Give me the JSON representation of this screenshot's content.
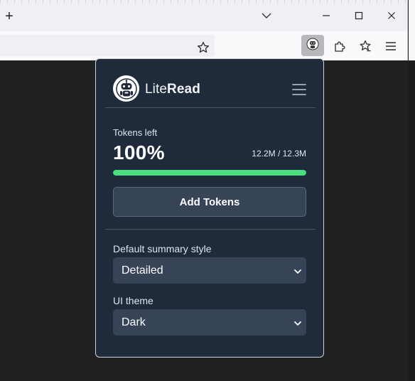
{
  "browser": {
    "new_tab_glyph": "+",
    "icons": {
      "new_tab": "plus-icon",
      "tab_list": "chevron-down-icon",
      "minimize": "minimize-icon",
      "maximize": "maximize-icon",
      "close": "close-icon",
      "bookmark": "star-icon",
      "active_extension": "robot-icon",
      "extensions": "puzzle-piece-icon",
      "favorites": "star-list-icon",
      "menu": "hamburger-menu-icon"
    }
  },
  "popup": {
    "brand": {
      "prefix": "Lite",
      "suffix": "Read"
    },
    "logo_icon": "robot-icon",
    "menu_icon": "hamburger-menu-icon",
    "tokens": {
      "label": "Tokens left",
      "percent_text": "100%",
      "count_text": "12.2M / 12.3M",
      "progress_fraction": 1.0,
      "progress_color": "#4ade80"
    },
    "add_tokens_label": "Add Tokens",
    "summary_style": {
      "label": "Default summary style",
      "value": "Detailed"
    },
    "ui_theme": {
      "label": "UI theme",
      "value": "Dark"
    }
  },
  "colors": {
    "popup_bg": "#1f2a3a",
    "control_bg": "#374357",
    "accent_green": "#4ade80"
  }
}
